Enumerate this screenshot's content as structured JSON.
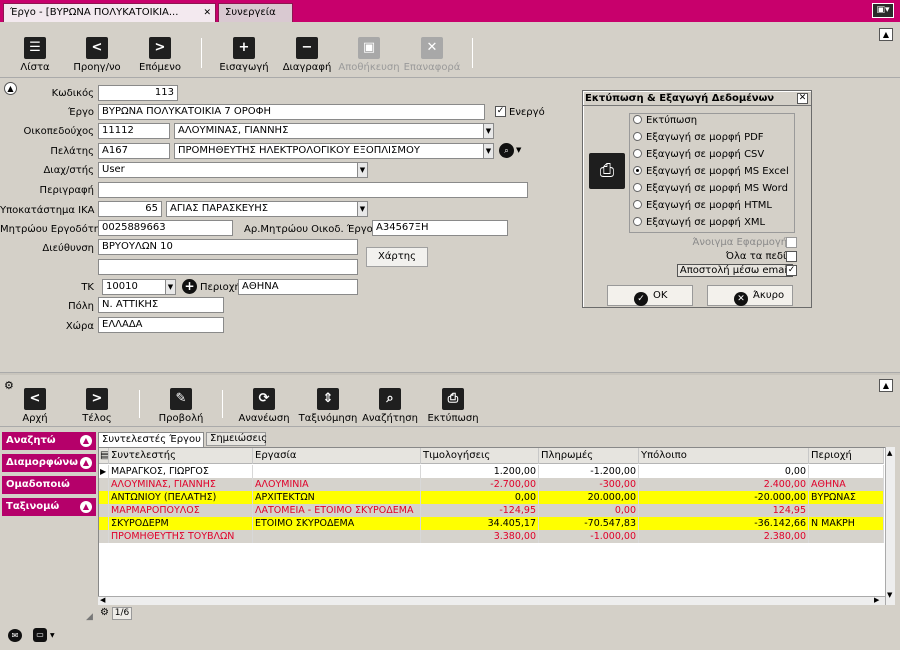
{
  "tabs": [
    {
      "label": "Έργο - [ΒΥΡΩΝΑ ΠΟΛΥΚΑΤΟΙΚΙΑ...",
      "close": "✕"
    },
    {
      "label": "Συνεργεία"
    }
  ],
  "toolbar": {
    "list": "Λίστα",
    "prev": "Προηγ/νο",
    "next": "Επόμενο",
    "insert": "Εισαγωγή",
    "delete": "Διαγραφή",
    "save": "Αποθήκευση",
    "restore": "Επαναφορά"
  },
  "form": {
    "code_label": "Κωδικός",
    "code": "113",
    "project_label": "Έργο",
    "project": "ΒΥΡΩΝΑ ΠΟΛΥΚΑΤΟΙΚΙΑ 7 ΟΡΟΦΗ",
    "active_label": "Ενεργό",
    "active_checked": "✓",
    "owner_label": "Οικοπεδούχος",
    "owner_code": "11112",
    "owner_name": "ΑΛΟΥΜΙΝΑΣ, ΓΙΑΝΝΗΣ",
    "client_label": "Πελάτης",
    "client_code": "A167",
    "client_name": "ΠΡΟΜΗΘΕΥΤΗΣ ΗΛΕΚΤΡΟΛΟΓΙΚΟΥ ΕΞΟΠΛΙΣΜΟΥ",
    "manager_label": "Διαχ/στής",
    "manager": "User",
    "description_label": "Περιγραφή",
    "description": "",
    "ika_label": "Υποκατάστημα ΙΚΑ",
    "ika_code": "65",
    "ika_name": "ΑΓΙΑΣ ΠΑΡΑΣΚΕΥΗΣ",
    "employer_label": "Μητρώου Εργοδότη",
    "employer": "0025889663",
    "reg_label": "Αρ.Μητρώου Οικοδ. Έργου",
    "reg": "Α34567ΞΗ",
    "address_label": "Διεύθυνση",
    "address": "ΒΡΥΟΥΛΩΝ 10",
    "address2": "",
    "map_button": "Χάρτης",
    "zip_label": "ΤΚ",
    "zip": "10010",
    "area_label": "Περιοχή",
    "area": "ΑΘΗΝΑ",
    "city_label": "Πόλη",
    "city": "Ν. ΑΤΤΙΚΗΣ",
    "country_label": "Χώρα",
    "country": "ΕΛΛΑΔΑ"
  },
  "dialog": {
    "title": "Εκτύπωση & Εξαγωγή Δεδομένων",
    "options": [
      {
        "label": "Εκτύπωση",
        "selected": false
      },
      {
        "label": "Εξαγωγή σε μορφή PDF",
        "selected": false
      },
      {
        "label": "Εξαγωγή σε μορφή CSV",
        "selected": false
      },
      {
        "label": "Εξαγωγή σε μορφή MS Excel",
        "selected": true
      },
      {
        "label": "Εξαγωγή σε μορφή MS Word",
        "selected": false
      },
      {
        "label": "Εξαγωγή σε μορφή HTML",
        "selected": false
      },
      {
        "label": "Εξαγωγή σε μορφή XML",
        "selected": false
      }
    ],
    "open_app": "Άνοιγμα Εφαρμογής",
    "all_fields": "Όλα τα πεδία",
    "send_email": "Αποστολή μέσω email",
    "send_email_checked": "✓",
    "ok": "OK",
    "cancel": "Άκυρο"
  },
  "toolbar2": {
    "first": "Αρχή",
    "last": "Τέλος",
    "view": "Προβολή",
    "refresh": "Ανανέωση",
    "sort": "Ταξινόμηση",
    "search": "Αναζήτηση",
    "print": "Εκτύπωση"
  },
  "sidebar": [
    "Αναζητώ",
    "Διαμορφώνω",
    "Ομαδοποιώ",
    "Ταξινομώ"
  ],
  "subtabs": [
    "Συντελεστές Έργου",
    "Σημειώσεις"
  ],
  "grid": {
    "columns": [
      "Συντελεστής",
      "Εργασία",
      "Τιμολογήσεις",
      "Πληρωμές",
      "Υπόλοιπο",
      "Περιοχή"
    ],
    "rows": [
      {
        "name": "ΜΑΡΑΓΚΟΣ, ΓΙΩΡΓΟΣ",
        "work": "",
        "invoices": "1.200,00",
        "payments": "-1.200,00",
        "balance": "0,00",
        "area": "",
        "style": "white",
        "red": false
      },
      {
        "name": "ΑΛΟΥΜΙΝΑΣ, ΓΙΑΝΝΗΣ",
        "work": "ΑΛΟΥΜΙΝΙΑ",
        "invoices": "-2.700,00",
        "payments": "-300,00",
        "balance": "2.400,00",
        "area": "ΑΘΗΝΑ",
        "style": "gray",
        "red": true
      },
      {
        "name": "ΑΝΤΩΝΙΟΥ (ΠΕΛΑΤΗΣ)",
        "work": "ΑΡΧΙΤΕΚΤΩΝ",
        "invoices": "0,00",
        "payments": "20.000,00",
        "balance": "-20.000,00",
        "area": "ΒΥΡΩΝΑΣ",
        "style": "yellow",
        "red": false
      },
      {
        "name": "ΜΑΡΜΑΡΟΠΟΥΛΟΣ",
        "work": "ΛΑΤΟΜΕΙΑ - ΕΤΟΙΜΟ ΣΚΥΡΟΔΕΜΑ",
        "invoices": "-124,95",
        "payments": "0,00",
        "balance": "124,95",
        "area": "",
        "style": "gray",
        "red": true
      },
      {
        "name": "ΣΚΥΡΟΔΕΡΜ",
        "work": "ΕΤΟΙΜΟ ΣΚΥΡΟΔΕΜΑ",
        "invoices": "34.405,17",
        "payments": "-70.547,83",
        "balance": "-36.142,66",
        "area": "Ν ΜΑΚΡΗ",
        "style": "yellow",
        "red": false
      },
      {
        "name": "ΠΡΟΜΗΘΕΥΤΗΣ ΤΟΥΒΛΩΝ",
        "work": "",
        "invoices": "3.380,00",
        "payments": "-1.000,00",
        "balance": "2.380,00",
        "area": "",
        "style": "gray",
        "red": true
      }
    ]
  },
  "pager": "1/6",
  "icons": {
    "list": "list-icon",
    "prev": "chevron-left-icon",
    "next": "chevron-right-icon",
    "insert": "plus-icon",
    "delete": "minus-icon",
    "save": "floppy-icon",
    "restore": "x-icon"
  },
  "colors": {
    "accent": "#c8006c",
    "yellow_row": "#ffff00",
    "red_text": "#e0002a"
  }
}
